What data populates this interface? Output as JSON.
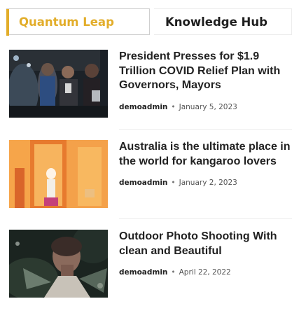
{
  "tabs": [
    {
      "label": "Quantum Leap",
      "active": true
    },
    {
      "label": "Knowledge Hub",
      "active": false
    }
  ],
  "colors": {
    "accent": "#e2ad2a",
    "text": "#222222",
    "meta": "#555555",
    "border": "#cfcfcf"
  },
  "posts": [
    {
      "title": "President Presses for $1.9 Trillion COVID Relief Plan with Governors, Mayors",
      "author": "demoadmin",
      "separator": "•",
      "date": "January 5, 2023",
      "thumbnail_icon": "people-at-night-photo"
    },
    {
      "title": "Australia is the ultimate place in the world for kangaroo lovers",
      "author": "demoadmin",
      "separator": "•",
      "date": "January 2, 2023",
      "thumbnail_icon": "woman-in-orange-doorway-photo"
    },
    {
      "title": "Outdoor Photo Shooting With clean and Beautiful",
      "author": "demoadmin",
      "separator": "•",
      "date": "April 22, 2022",
      "thumbnail_icon": "portrait-in-foliage-photo"
    }
  ]
}
